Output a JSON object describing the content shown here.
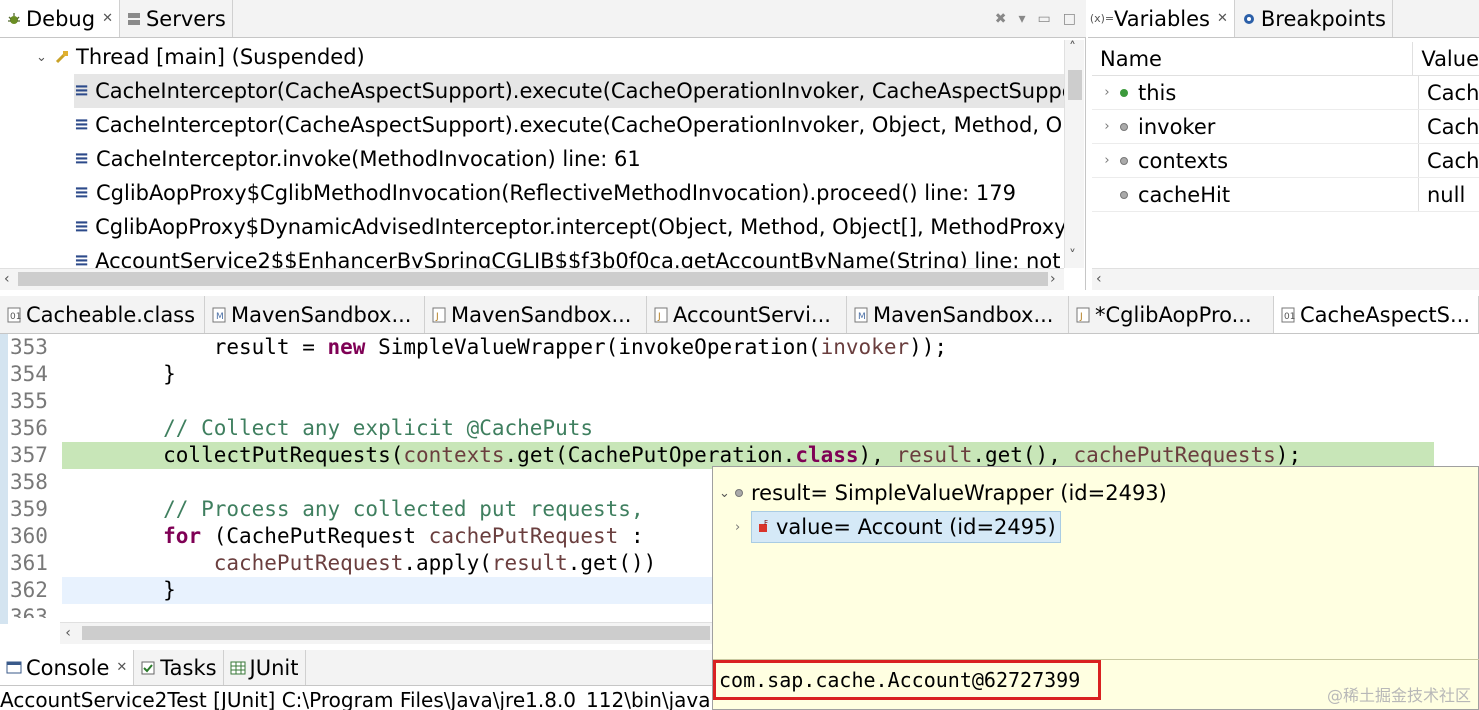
{
  "debug_view": {
    "tabs": [
      {
        "label": "Debug",
        "icon": "debug-bug-icon",
        "active": true,
        "closable": true
      },
      {
        "label": "Servers",
        "icon": "servers-icon",
        "active": false,
        "closable": false
      }
    ],
    "thread": {
      "label": "Thread [main] (Suspended)",
      "expanded": true
    },
    "frames": [
      "CacheInterceptor(CacheAspectSupport).execute(CacheOperationInvoker, CacheAspectSupport$",
      "CacheInterceptor(CacheAspectSupport).execute(CacheOperationInvoker, Object, Method, Obje",
      "CacheInterceptor.invoke(MethodInvocation) line: 61",
      "CglibAopProxy$CglibMethodInvocation(ReflectiveMethodInvocation).proceed() line: 179",
      "CglibAopProxy$DynamicAdvisedInterceptor.intercept(Object, Method, Object[], MethodProxy)",
      "AccountService2$$EnhancerBySpringCGLIB$$f3b0f0ca.getAccountByName(String) line: not avai"
    ],
    "selected_frame": 0
  },
  "variables_view": {
    "tabs": [
      {
        "label": "Variables",
        "icon": "variables-icon",
        "active": true,
        "closable": true
      },
      {
        "label": "Breakpoints",
        "icon": "breakpoints-icon",
        "active": false,
        "closable": false
      }
    ],
    "columns": [
      "Name",
      "Value"
    ],
    "rows": [
      {
        "name": "this",
        "value": "Cache",
        "expandable": true
      },
      {
        "name": "invoker",
        "value": "Cache",
        "expandable": true
      },
      {
        "name": "contexts",
        "value": "Cache",
        "expandable": true
      },
      {
        "name": "cacheHit",
        "value": "null",
        "expandable": false
      }
    ]
  },
  "editor": {
    "tabs": [
      {
        "label": "Cacheable.class"
      },
      {
        "label": "MavenSandbox..."
      },
      {
        "label": "MavenSandbox..."
      },
      {
        "label": "AccountServi..."
      },
      {
        "label": "MavenSandbox..."
      },
      {
        "label": "*CglibAopPro..."
      },
      {
        "label": "CacheAspectS...",
        "active": true
      }
    ],
    "line_numbers": [
      "353",
      "354",
      "355",
      "356",
      "357",
      "358",
      "359",
      "360",
      "361",
      "362",
      "363"
    ],
    "highlighted_line": "357",
    "code": {
      "l353_a": "            result = ",
      "l353_kw": "new",
      "l353_b": " SimpleValueWrapper(invokeOperation(",
      "l353_var": "invoker",
      "l353_c": "));",
      "l354": "        }",
      "l356_comment": "        // Collect any explicit @CachePuts",
      "l357_a": "        collectPutRequests(",
      "l357_v1": "contexts",
      "l357_b": ".get(CachePutOperation.",
      "l357_kw": "class",
      "l357_c": "), ",
      "l357_v2": "result",
      "l357_d": ".get(), ",
      "l357_v3": "cachePutRequests",
      "l357_e": ");",
      "l359_comment": "        // Process any collected put requests,",
      "l360_kw": "for",
      "l360_a": " (CachePutRequest ",
      "l360_var": "cachePutRequest",
      "l360_b": " :",
      "l361_var1": "cachePutRequest",
      "l361_a": ".apply(",
      "l361_var2": "result",
      "l361_b": ".get())",
      "l362": "        }"
    }
  },
  "hover_popup": {
    "root": "result= SimpleValueWrapper  (id=2493)",
    "child": "value= Account  (id=2495)",
    "detail": "com.sap.cache.Account@62727399",
    "detail_highlight_color": "#d92121"
  },
  "console_view": {
    "tabs": [
      {
        "label": "Console",
        "icon": "console-icon",
        "active": true,
        "closable": true
      },
      {
        "label": "Tasks",
        "icon": "tasks-icon",
        "active": false
      },
      {
        "label": "JUnit",
        "icon": "junit-icon",
        "active": false
      }
    ],
    "text": "AccountService2Test [JUnit] C:\\Program Files\\Java\\jre1.8.0_112\\bin\\java"
  },
  "watermark": "@稀土掘金技术社区",
  "colors": {
    "highlight_line": "#c8e6b8",
    "hover_background": "#ffffe1",
    "keyword": "#7f0055",
    "comment": "#3f7f5f"
  }
}
